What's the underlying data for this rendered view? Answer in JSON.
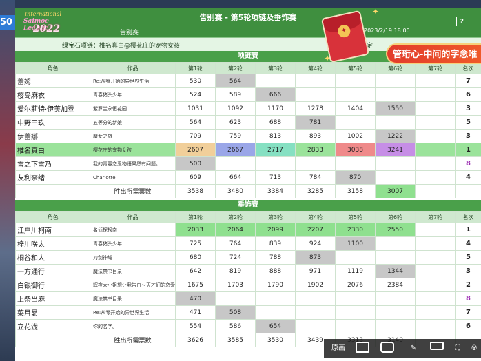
{
  "sidebar_number": "50",
  "header": {
    "title": "告别赛 - 第5轮项链及垂饰赛",
    "sub_left": "告别赛",
    "date": "2023/2/19 18:00",
    "help": "?"
  },
  "logo": {
    "line1": "International",
    "line2": "Saimoe League",
    "line3": "2022"
  },
  "info": {
    "text": "绿宝石项链：椎名真白@樱花庄的宠物女孩",
    "right": "定"
  },
  "necklace": {
    "title": "项链赛",
    "headers": [
      "角色",
      "作品",
      "第1轮",
      "第2轮",
      "第3轮",
      "第4轮",
      "第5轮",
      "第6轮",
      "第7轮",
      "名次"
    ],
    "rows": [
      {
        "name": "蕾姆",
        "work": "Re:从零开始的异世界生活",
        "r": [
          "530",
          "564",
          "",
          "",
          "",
          "",
          ""
        ],
        "rank": "7"
      },
      {
        "name": "樱岛麻衣",
        "work": "青春猪头少年",
        "r": [
          "524",
          "589",
          "666",
          "",
          "",
          "",
          ""
        ],
        "rank": "6"
      },
      {
        "name": "爱尔莉特·伊芙加登",
        "work": "紫罗兰永恒花园",
        "r": [
          "1031",
          "1092",
          "1170",
          "1278",
          "1404",
          "1550",
          ""
        ],
        "rank": "3"
      },
      {
        "name": "中野三玖",
        "work": "五等分的新娘",
        "r": [
          "564",
          "623",
          "688",
          "781",
          "",
          "",
          ""
        ],
        "rank": "5"
      },
      {
        "name": "伊蕾娜",
        "work": "魔女之旅",
        "r": [
          "709",
          "759",
          "813",
          "893",
          "1002",
          "1222",
          ""
        ],
        "rank": "3"
      },
      {
        "name": "椎名真白",
        "work": "樱花庄的宠物女孩",
        "r": [
          "2607",
          "2667",
          "2717",
          "2833",
          "3038",
          "3241",
          ""
        ],
        "rank": "1"
      },
      {
        "name": "雪之下雪乃",
        "work": "我的青春恋爱物语果然有问题。",
        "r": [
          "500",
          "",
          "",
          "",
          "",
          "",
          ""
        ],
        "rank": "8"
      },
      {
        "name": "友利奈绪",
        "work": "Charlotte",
        "r": [
          "609",
          "664",
          "713",
          "784",
          "870",
          "",
          ""
        ],
        "rank": "4"
      }
    ],
    "total_label": "胜出所需票数",
    "totals": [
      "3538",
      "3480",
      "3384",
      "3285",
      "3158",
      "3007",
      ""
    ]
  },
  "pendant": {
    "title": "垂饰赛",
    "headers": [
      "角色",
      "作品",
      "第1轮",
      "第2轮",
      "第3轮",
      "第4轮",
      "第5轮",
      "第6轮",
      "第7轮",
      "名次"
    ],
    "rows": [
      {
        "name": "江户川柯南",
        "work": "名侦探柯南",
        "r": [
          "2033",
          "2064",
          "2099",
          "2207",
          "2330",
          "2550",
          ""
        ],
        "rank": "1"
      },
      {
        "name": "梓川咲太",
        "work": "青春猪头少年",
        "r": [
          "725",
          "764",
          "839",
          "924",
          "1100",
          "",
          ""
        ],
        "rank": "4"
      },
      {
        "name": "桐谷和人",
        "work": "刀剑神域",
        "r": [
          "680",
          "724",
          "788",
          "873",
          "",
          "",
          ""
        ],
        "rank": "5"
      },
      {
        "name": "一方通行",
        "work": "魔法禁书目录",
        "r": [
          "642",
          "819",
          "888",
          "971",
          "1119",
          "1344",
          ""
        ],
        "rank": "3"
      },
      {
        "name": "白银御行",
        "work": "辉夜大小姐想让我告白～天才们的恋爱头脑战～",
        "r": [
          "1675",
          "1703",
          "1790",
          "1902",
          "2076",
          "2384",
          ""
        ],
        "rank": "2"
      },
      {
        "name": "上条当麻",
        "work": "魔法禁书目录",
        "r": [
          "470",
          "",
          "",
          "",
          "",
          "",
          ""
        ],
        "rank": "8"
      },
      {
        "name": "菜月昴",
        "work": "Re:从零开始的异世界生活",
        "r": [
          "471",
          "508",
          "",
          "",
          "",
          "",
          ""
        ],
        "rank": "7"
      },
      {
        "name": "立花泷",
        "work": "你的名字。",
        "r": [
          "554",
          "586",
          "654",
          "",
          "",
          "",
          ""
        ],
        "rank": "6"
      }
    ],
    "total_label": "胜出所需票数",
    "totals": [
      "3626",
      "3585",
      "3530",
      "3439",
      "3313",
      "3140",
      ""
    ]
  },
  "banner": {
    "text": "管珩心-中间的字念唯"
  },
  "toolbar": {
    "restore_label": "原画"
  }
}
